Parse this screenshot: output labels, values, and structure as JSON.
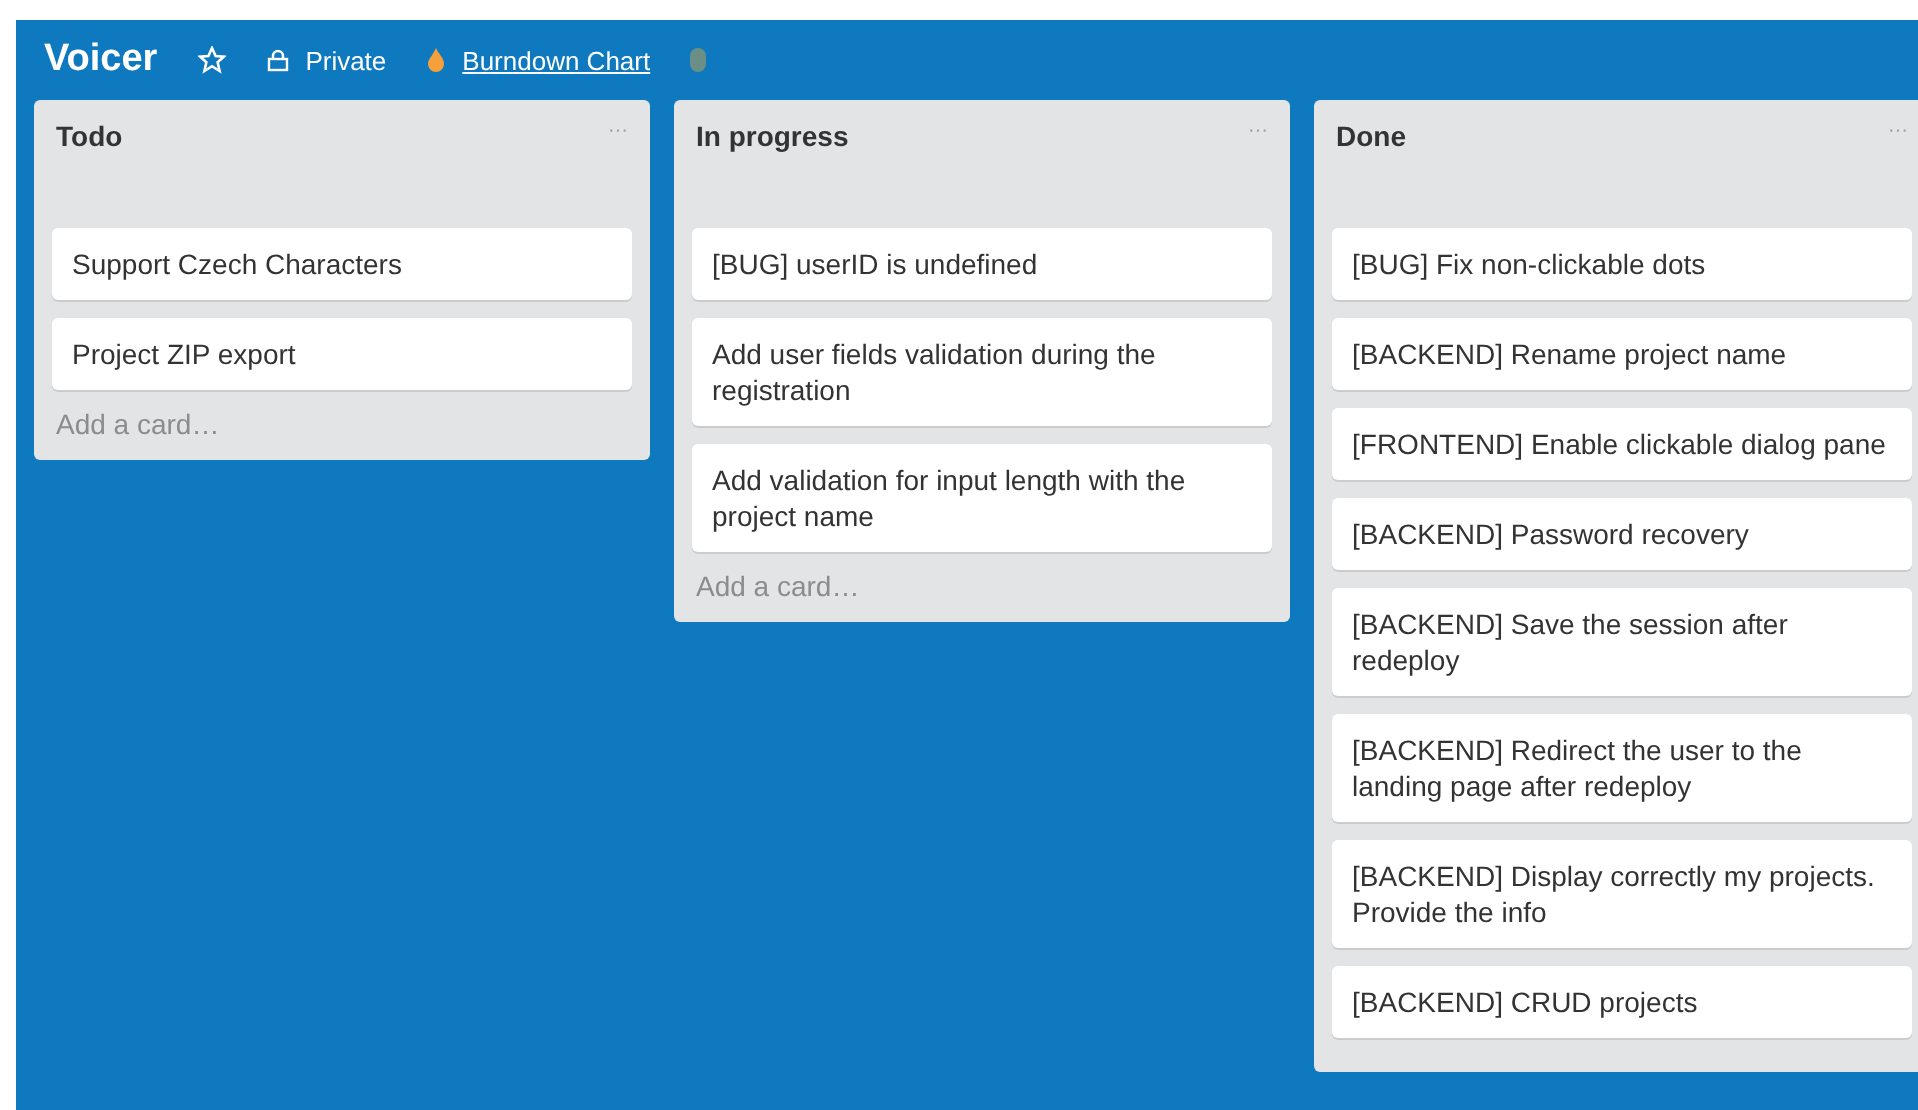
{
  "board": {
    "title": "Voicer",
    "starred": false,
    "visibility": "Private",
    "link": "Burndown Chart"
  },
  "lists": [
    {
      "title": "Todo",
      "menu": "···",
      "cards": [
        "Support Czech Characters",
        "Project ZIP export"
      ],
      "add": "Add a card…"
    },
    {
      "title": "In progress",
      "menu": "···",
      "cards": [
        "[BUG] userID is undefined",
        "Add user fields validation during the registration",
        "Add validation for input length with the project name"
      ],
      "add": "Add a card…"
    },
    {
      "title": "Done",
      "menu": "···",
      "cards": [
        "[BUG] Fix non-clickable dots",
        "[BACKEND] Rename project name",
        "[FRONTEND] Enable clickable dialog pane",
        "[BACKEND] Password recovery",
        "[BACKEND] Save the session after redeploy",
        "[BACKEND] Redirect the user to the landing page after redeploy",
        "[BACKEND] Display correctly my projects. Provide the info",
        "[BACKEND] CRUD projects"
      ]
    }
  ]
}
